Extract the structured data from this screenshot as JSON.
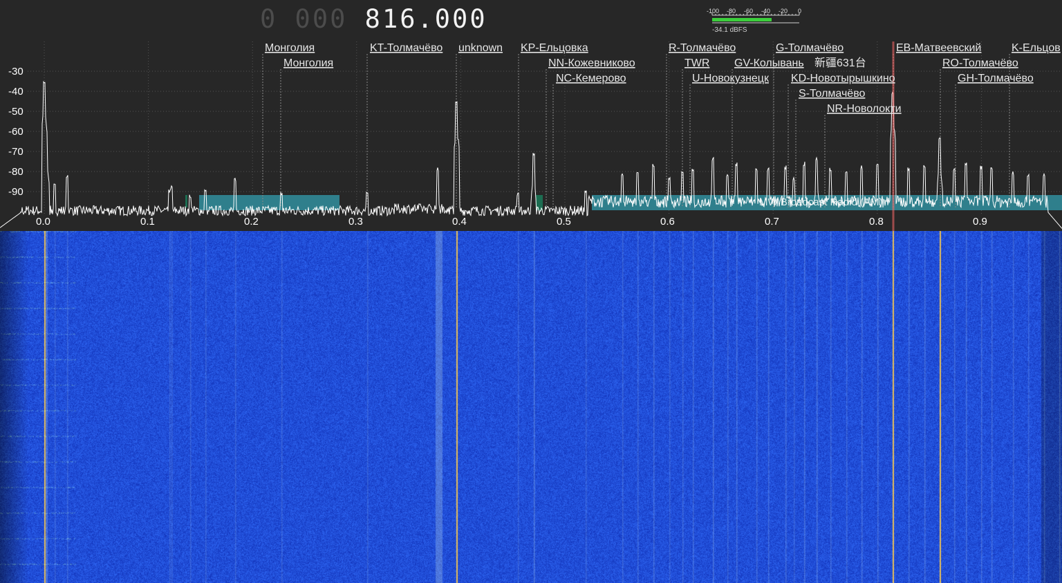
{
  "frequency": {
    "dim_digits": "0 000",
    "main_digits": "816.000"
  },
  "level_meter": {
    "scale_labels": [
      "-100",
      "-80",
      "-60",
      "-40",
      "-20",
      "0"
    ],
    "readout": "-34.1 dBFS",
    "level_dbfs": -34.1,
    "bar_color": "#3ccf3c"
  },
  "spectrum": {
    "db_axis": [
      "-30",
      "-40",
      "-50",
      "-60",
      "-70",
      "-80",
      "-90"
    ],
    "freq_axis": [
      "0.0",
      "0.1",
      "0.2",
      "0.3",
      "0.4",
      "0.5",
      "0.6",
      "0.7",
      "0.8",
      "0.9"
    ],
    "band_label": "MW Broadcast Radio (AM)",
    "band_color": "#2f7f8c",
    "trace_color": "#ffffff",
    "tuned_marker_color": "#ff6a6a"
  },
  "stations": [
    {
      "label": "Монголия"
    },
    {
      "label": "Монголия"
    },
    {
      "label": "KT-Толмачёво"
    },
    {
      "label": "unknown"
    },
    {
      "label": "KP-Ельцовка"
    },
    {
      "label": "NN-Кожевниково"
    },
    {
      "label": "NC-Кемерово"
    },
    {
      "label": "R-Толмачёво"
    },
    {
      "label": "TWR"
    },
    {
      "label": "U-Новокузнецк"
    },
    {
      "label": "GV-Колывань"
    },
    {
      "label": "G-Толмачёво"
    },
    {
      "label": "新疆631台"
    },
    {
      "label": "KD-Новотырышкино"
    },
    {
      "label": "S-Толмачёво"
    },
    {
      "label": "NR-Новолокти"
    },
    {
      "label": "EB-Матвеевский"
    },
    {
      "label": "RO-Толмачёво"
    },
    {
      "label": "GH-Толмачёво"
    },
    {
      "label": "K-Ельцов"
    }
  ],
  "waterfall": {
    "base_color": "#1f47d9",
    "edge_color": "#10248f",
    "signal_color": "#e8c060"
  }
}
